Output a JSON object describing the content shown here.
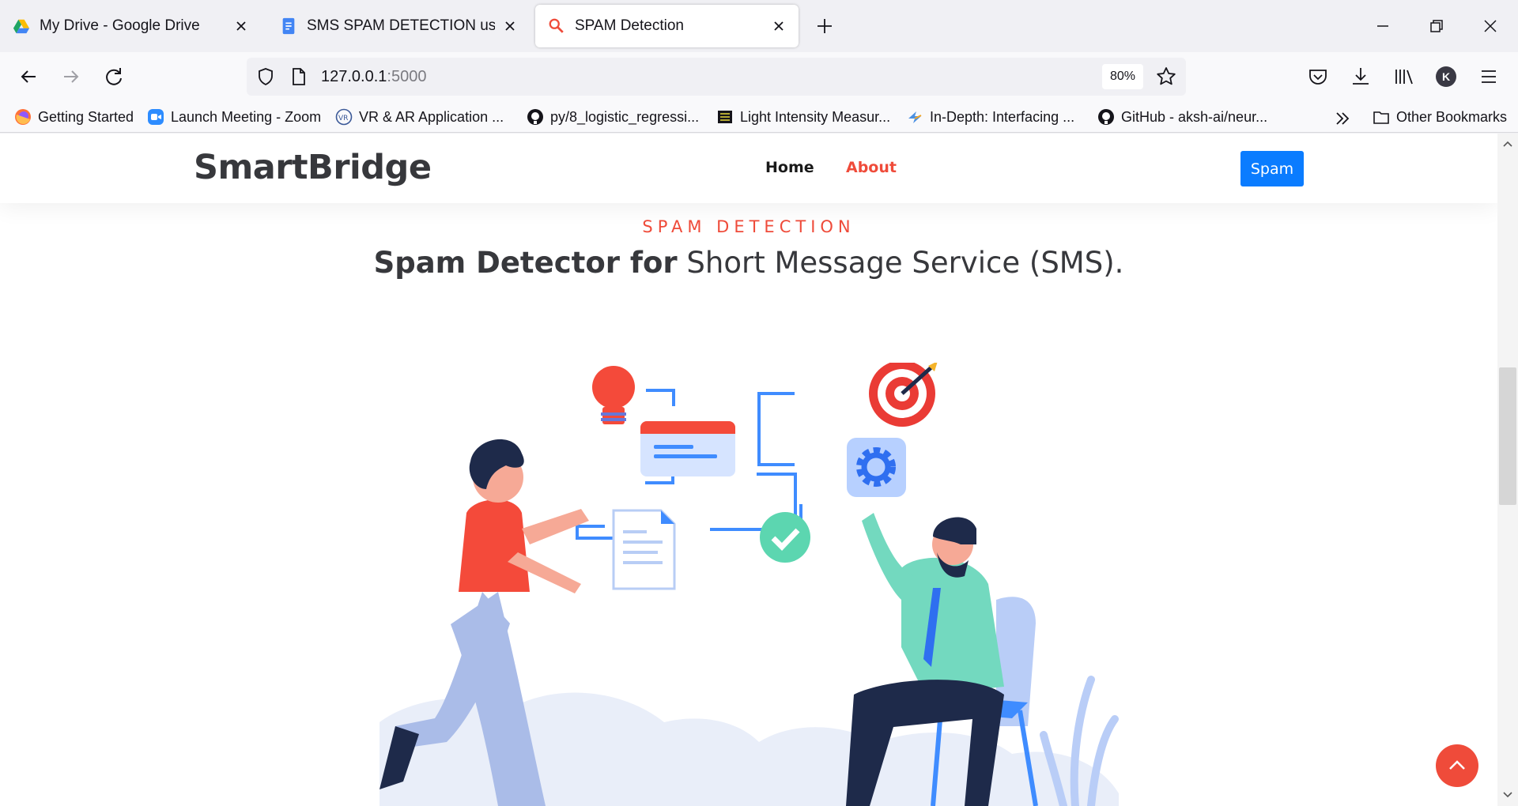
{
  "browser": {
    "tabs": [
      {
        "title": "My Drive - Google Drive",
        "icon": "google-drive-icon"
      },
      {
        "title": "SMS SPAM DETECTION using IBM Watson",
        "icon": "google-docs-icon"
      },
      {
        "title": "SPAM Detection",
        "icon": "magnifier-icon"
      }
    ],
    "url_host": "127.0.0.1",
    "url_port": ":5000",
    "zoom": "80%",
    "avatar_letter": "K",
    "bookmarks": [
      {
        "label": "Getting Started",
        "icon": "firefox-icon"
      },
      {
        "label": "Launch Meeting - Zoom",
        "icon": "zoom-icon"
      },
      {
        "label": "VR & AR Application ...",
        "icon": "vr-icon"
      },
      {
        "label": "py/8_logistic_regressi...",
        "icon": "github-icon"
      },
      {
        "label": "Light Intensity Measur...",
        "icon": "chip-icon"
      },
      {
        "label": "In-Depth: Interfacing ...",
        "icon": "bolt-icon"
      },
      {
        "label": "GitHub - aksh-ai/neur...",
        "icon": "github-icon"
      }
    ],
    "other_bookmarks": "Other Bookmarks"
  },
  "site": {
    "logo": "SmartBridge",
    "nav": {
      "home": "Home",
      "about": "About"
    },
    "cta": "Spam",
    "kicker": "SPAM DETECTION",
    "headline_bold": "Spam Detector for",
    "headline_rest": " Short Message Service (SMS)."
  },
  "colors": {
    "accent_red": "#ef4b3a",
    "cta_blue": "#0a7cff",
    "text_dark": "#37383c"
  }
}
